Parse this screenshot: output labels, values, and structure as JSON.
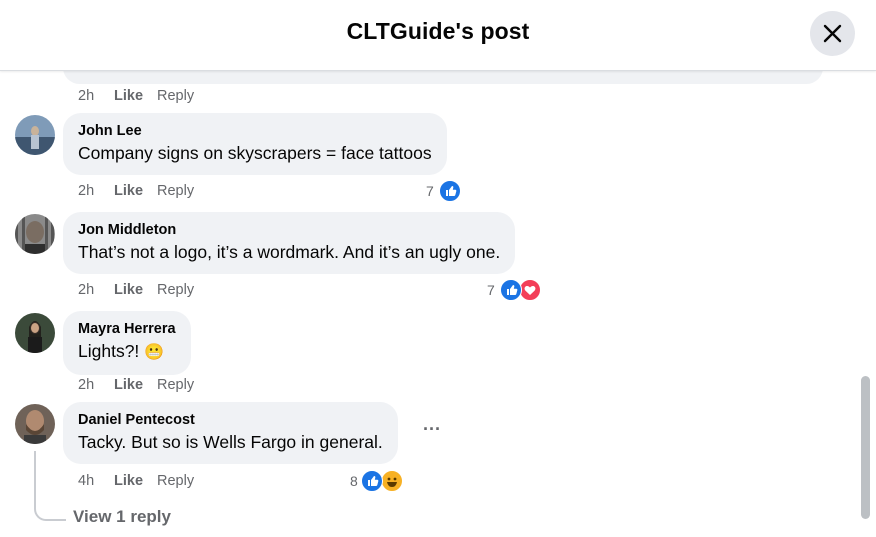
{
  "header": {
    "title": "CLTGuide's post"
  },
  "previous_comment": {
    "time": "2h",
    "like_label": "Like",
    "reply_label": "Reply"
  },
  "comments": [
    {
      "author": "John Lee",
      "text": "Company signs on skyscrapers = face tattoos",
      "time": "2h",
      "like_label": "Like",
      "reply_label": "Reply",
      "reaction_count": "7",
      "reactions": [
        "like"
      ]
    },
    {
      "author": "Jon Middleton",
      "text": "That’s not a logo, it’s a wordmark. And it’s an ugly one.",
      "time": "2h",
      "like_label": "Like",
      "reply_label": "Reply",
      "reaction_count": "7",
      "reactions": [
        "like",
        "love"
      ]
    },
    {
      "author": "Mayra Herrera",
      "text": "Lights?!",
      "emoji": "😬",
      "time": "2h",
      "like_label": "Like",
      "reply_label": "Reply"
    },
    {
      "author": "Daniel Pentecost",
      "text": "Tacky. But so is Wells Fargo in general.",
      "time": "4h",
      "like_label": "Like",
      "reply_label": "Reply",
      "reaction_count": "8",
      "reactions": [
        "like",
        "haha"
      ],
      "more_label": "···"
    }
  ],
  "view_replies": "View 1 reply",
  "colors": {
    "bubble": "#f0f2f5",
    "like": "#1b74e4",
    "love": "#f33e58",
    "haha": "#f7b125",
    "secondary_text": "#65676b"
  },
  "icons": [
    "close-icon",
    "like-reaction-icon",
    "love-reaction-icon",
    "haha-reaction-icon",
    "more-options-icon"
  ]
}
